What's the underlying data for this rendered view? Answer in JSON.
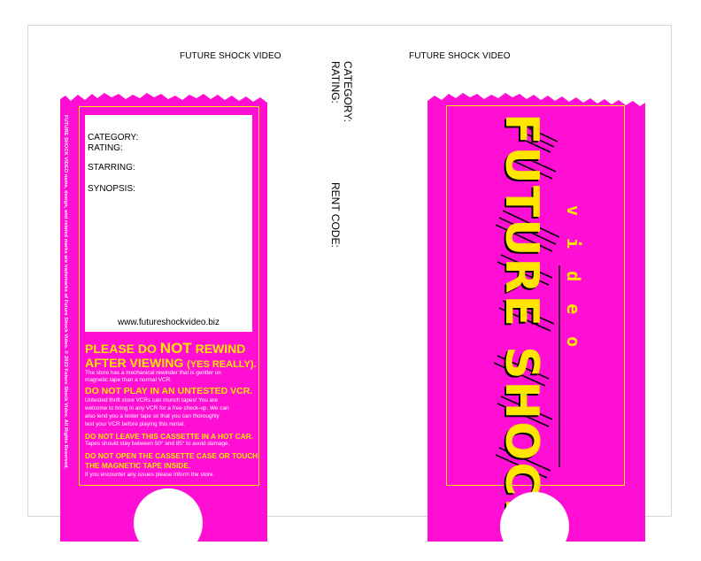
{
  "header": {
    "left_title": "FUTURE SHOCK VIDEO",
    "right_title": "FUTURE SHOCK VIDEO"
  },
  "spine": {
    "category_label": "CATEGORY:",
    "rating_label": "RATING:",
    "rent_code_label": "RENT CODE:"
  },
  "back_panel": {
    "legal_text": "FUTURE SHOCK VIDEO name, design, and related marks are trademarks of Future Shock Video. © 2023 Future Shock Video. All Rights Reserved.",
    "fields": {
      "category": "CATEGORY:",
      "rating": "RATING:",
      "starring": "STARRING:",
      "synopsis": "SYNOPSIS:"
    },
    "website": "www.futureshockvideo.biz",
    "rewind": {
      "line1_a": "PLEASE DO ",
      "line1_b": "NOT",
      "line1_c": " REWIND",
      "line2_a": "AFTER VIEWING ",
      "line2_b": "(YES REALLY).",
      "body1": "The store has a mechanical rewinder that is gentler on",
      "body2": "magnetic tape than a normal VCR."
    },
    "untested": {
      "heading": "DO NOT PLAY IN AN UNTESTED VCR.",
      "body1": "Untested thrift store VCRs can munch tapes! You are",
      "body2": "welcome to bring in any VCR for a free check-up. We can",
      "body3": "also lend you a tester tape so that you can thoroughly",
      "body4": "test your VCR before playing this rental."
    },
    "hotcar": {
      "heading": "DO NOT LEAVE THIS CASSETTE IN A HOT CAR.",
      "body": "Tapes should stay between 50° and 85° to avoid damage."
    },
    "opencase": {
      "heading1": "DO NOT OPEN THE CASSETTE CASE OR TOUCH",
      "heading2": "THE MAGNETIC TAPE INSIDE.",
      "body": "If you encounter any issues please inform the store."
    }
  },
  "front_panel": {
    "logo_main": "FUTURE SHOCK",
    "logo_sub": "video"
  },
  "colors": {
    "magenta": "#ff0fd3",
    "yellow": "#ffe500",
    "white": "#ffffff",
    "black": "#000000"
  }
}
